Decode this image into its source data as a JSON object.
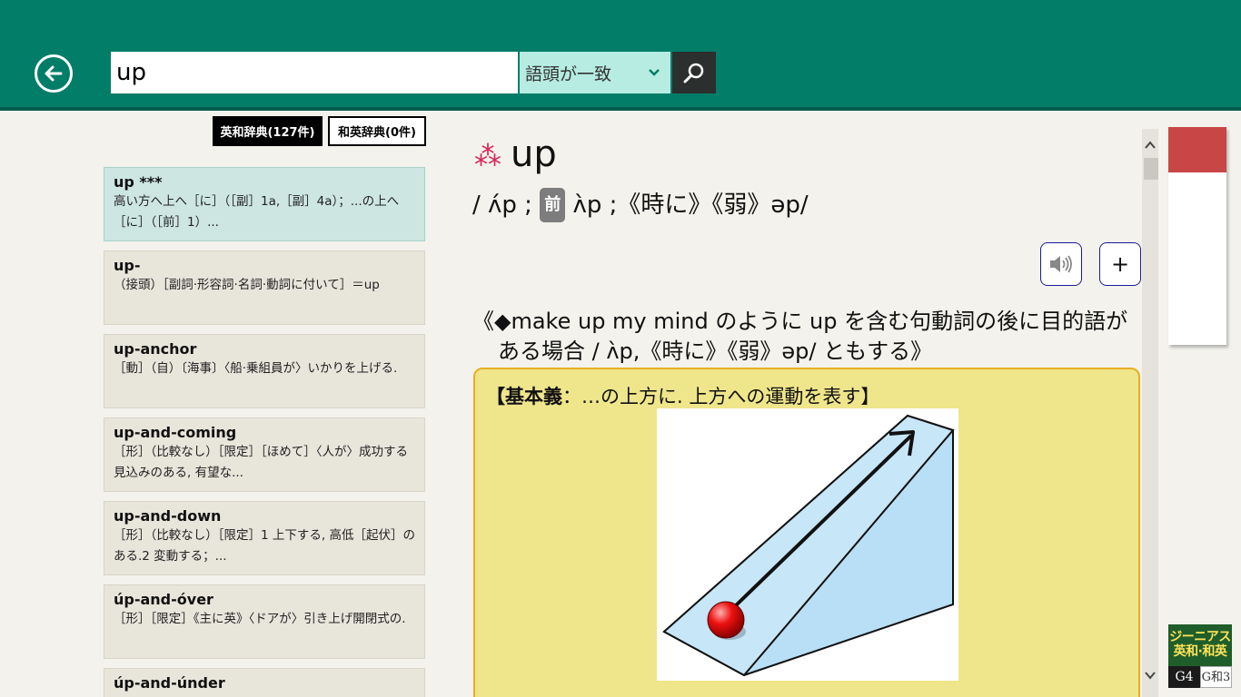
{
  "search": {
    "query": "up",
    "mode": "語頭が一致"
  },
  "tabs": [
    {
      "label": "英和辞典(127件)",
      "active": true
    },
    {
      "label": "和英辞典(0件)",
      "active": false
    }
  ],
  "results": [
    {
      "head": "up ***",
      "desc": "高い方へ上へ［に］（［副］1a,［副］4a）；...の上へ［に］（［前］1）..."
    },
    {
      "head": "up‐",
      "desc": "（接頭）［副詞·形容詞·名詞·動詞に付いて］＝up"
    },
    {
      "head": "up‐anchor",
      "desc": "［動］（自）〔海事〕〈船·乗組員が〉いかりを上げる."
    },
    {
      "head": "up‐and‐coming",
      "desc": "［形］（比較なし）［限定］［ほめて］〈人が〉成功する見込みのある, 有望な..."
    },
    {
      "head": "up‐and‐down",
      "desc": "［形］（比較なし）［限定］1 上下する, 高低［起伏］のある.2 変動する；..."
    },
    {
      "head": "úp‐and‐óver",
      "desc": "［形］［限定］《主に英》〈ドアが〉引き上げ開閉式の."
    },
    {
      "head": "úp‐and‐únder",
      "desc": ""
    }
  ],
  "entry": {
    "star": "⁂",
    "word": "up",
    "pron_a": "/ ʌ́p ;",
    "pron_mark": "前",
    "pron_b": "ʌ̀p ;《時に》《弱》əp/",
    "note": "《◆make up my mind のように up を含む句動詞の後に目的語がある場合 / ʌ̀p,《時に》《弱》əp/ ともする》",
    "panel_title_bold": "【基本義",
    "panel_title_rest": "：…の上方に. 上方への運動を表す】"
  },
  "buttons": {
    "plus": "+"
  },
  "logo": {
    "line1": "ジーニアス",
    "line2": "英和·和英",
    "g4": "G4",
    "gc": "G和3"
  },
  "colors": {
    "header": "#027d68",
    "accent_select": "#b6ece1",
    "panel": "#efe58b",
    "panel_border": "#e8ad24",
    "star": "#d8245b",
    "bookmark_red": "#c94646"
  },
  "icons": {
    "back": "arrow-left-circle-icon",
    "search": "magnifier-icon",
    "speaker": "speaker-icon",
    "dropdown": "chevron-down-icon"
  }
}
